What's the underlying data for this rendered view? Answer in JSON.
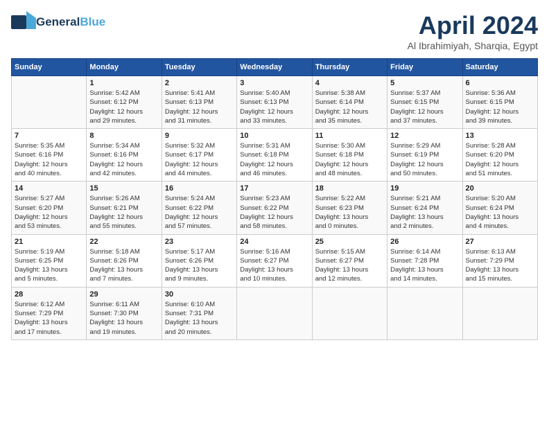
{
  "logo": {
    "general": "General",
    "blue": "Blue"
  },
  "header": {
    "month": "April 2024",
    "location": "Al Ibrahimiyah, Sharqia, Egypt"
  },
  "weekdays": [
    "Sunday",
    "Monday",
    "Tuesday",
    "Wednesday",
    "Thursday",
    "Friday",
    "Saturday"
  ],
  "weeks": [
    [
      {
        "day": "",
        "info": ""
      },
      {
        "day": "1",
        "info": "Sunrise: 5:42 AM\nSunset: 6:12 PM\nDaylight: 12 hours\nand 29 minutes."
      },
      {
        "day": "2",
        "info": "Sunrise: 5:41 AM\nSunset: 6:13 PM\nDaylight: 12 hours\nand 31 minutes."
      },
      {
        "day": "3",
        "info": "Sunrise: 5:40 AM\nSunset: 6:13 PM\nDaylight: 12 hours\nand 33 minutes."
      },
      {
        "day": "4",
        "info": "Sunrise: 5:38 AM\nSunset: 6:14 PM\nDaylight: 12 hours\nand 35 minutes."
      },
      {
        "day": "5",
        "info": "Sunrise: 5:37 AM\nSunset: 6:15 PM\nDaylight: 12 hours\nand 37 minutes."
      },
      {
        "day": "6",
        "info": "Sunrise: 5:36 AM\nSunset: 6:15 PM\nDaylight: 12 hours\nand 39 minutes."
      }
    ],
    [
      {
        "day": "7",
        "info": "Sunrise: 5:35 AM\nSunset: 6:16 PM\nDaylight: 12 hours\nand 40 minutes."
      },
      {
        "day": "8",
        "info": "Sunrise: 5:34 AM\nSunset: 6:16 PM\nDaylight: 12 hours\nand 42 minutes."
      },
      {
        "day": "9",
        "info": "Sunrise: 5:32 AM\nSunset: 6:17 PM\nDaylight: 12 hours\nand 44 minutes."
      },
      {
        "day": "10",
        "info": "Sunrise: 5:31 AM\nSunset: 6:18 PM\nDaylight: 12 hours\nand 46 minutes."
      },
      {
        "day": "11",
        "info": "Sunrise: 5:30 AM\nSunset: 6:18 PM\nDaylight: 12 hours\nand 48 minutes."
      },
      {
        "day": "12",
        "info": "Sunrise: 5:29 AM\nSunset: 6:19 PM\nDaylight: 12 hours\nand 50 minutes."
      },
      {
        "day": "13",
        "info": "Sunrise: 5:28 AM\nSunset: 6:20 PM\nDaylight: 12 hours\nand 51 minutes."
      }
    ],
    [
      {
        "day": "14",
        "info": "Sunrise: 5:27 AM\nSunset: 6:20 PM\nDaylight: 12 hours\nand 53 minutes."
      },
      {
        "day": "15",
        "info": "Sunrise: 5:26 AM\nSunset: 6:21 PM\nDaylight: 12 hours\nand 55 minutes."
      },
      {
        "day": "16",
        "info": "Sunrise: 5:24 AM\nSunset: 6:22 PM\nDaylight: 12 hours\nand 57 minutes."
      },
      {
        "day": "17",
        "info": "Sunrise: 5:23 AM\nSunset: 6:22 PM\nDaylight: 12 hours\nand 58 minutes."
      },
      {
        "day": "18",
        "info": "Sunrise: 5:22 AM\nSunset: 6:23 PM\nDaylight: 13 hours\nand 0 minutes."
      },
      {
        "day": "19",
        "info": "Sunrise: 5:21 AM\nSunset: 6:24 PM\nDaylight: 13 hours\nand 2 minutes."
      },
      {
        "day": "20",
        "info": "Sunrise: 5:20 AM\nSunset: 6:24 PM\nDaylight: 13 hours\nand 4 minutes."
      }
    ],
    [
      {
        "day": "21",
        "info": "Sunrise: 5:19 AM\nSunset: 6:25 PM\nDaylight: 13 hours\nand 5 minutes."
      },
      {
        "day": "22",
        "info": "Sunrise: 5:18 AM\nSunset: 6:26 PM\nDaylight: 13 hours\nand 7 minutes."
      },
      {
        "day": "23",
        "info": "Sunrise: 5:17 AM\nSunset: 6:26 PM\nDaylight: 13 hours\nand 9 minutes."
      },
      {
        "day": "24",
        "info": "Sunrise: 5:16 AM\nSunset: 6:27 PM\nDaylight: 13 hours\nand 10 minutes."
      },
      {
        "day": "25",
        "info": "Sunrise: 5:15 AM\nSunset: 6:27 PM\nDaylight: 13 hours\nand 12 minutes."
      },
      {
        "day": "26",
        "info": "Sunrise: 6:14 AM\nSunset: 7:28 PM\nDaylight: 13 hours\nand 14 minutes."
      },
      {
        "day": "27",
        "info": "Sunrise: 6:13 AM\nSunset: 7:29 PM\nDaylight: 13 hours\nand 15 minutes."
      }
    ],
    [
      {
        "day": "28",
        "info": "Sunrise: 6:12 AM\nSunset: 7:29 PM\nDaylight: 13 hours\nand 17 minutes."
      },
      {
        "day": "29",
        "info": "Sunrise: 6:11 AM\nSunset: 7:30 PM\nDaylight: 13 hours\nand 19 minutes."
      },
      {
        "day": "30",
        "info": "Sunrise: 6:10 AM\nSunset: 7:31 PM\nDaylight: 13 hours\nand 20 minutes."
      },
      {
        "day": "",
        "info": ""
      },
      {
        "day": "",
        "info": ""
      },
      {
        "day": "",
        "info": ""
      },
      {
        "day": "",
        "info": ""
      }
    ]
  ]
}
